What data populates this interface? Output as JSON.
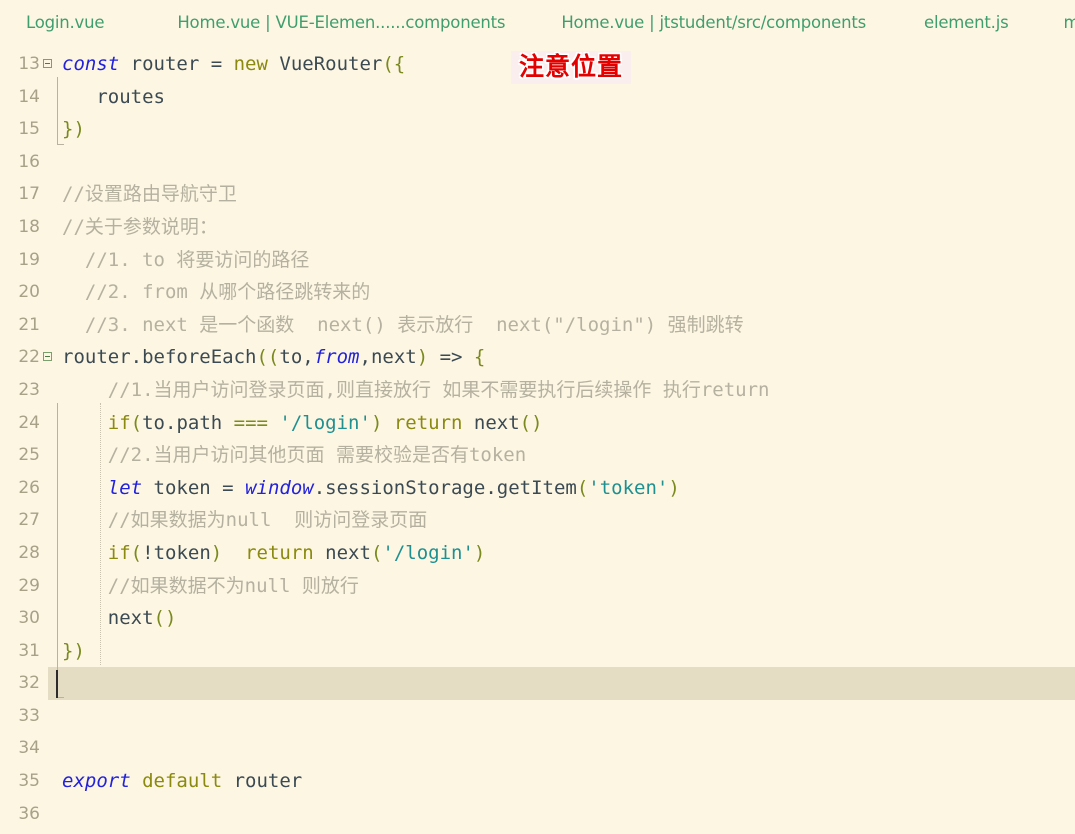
{
  "colors": {
    "editor_background": "#fdf6e3",
    "tab_text": "#3f9e6d",
    "line_number": "#a8a188",
    "comment": "#b5b1a0",
    "keyword": "#2222dd",
    "keyword2": "#8a8a10",
    "string": "#1f9090",
    "identifier": "#3b4a52",
    "current_line_highlight": "#e4dcc3",
    "annotation_text": "#e50000",
    "annotation_background": "#fbeeee"
  },
  "tabs": [
    {
      "label": "Login.vue"
    },
    {
      "label": "Home.vue | VUE-Elemen......components"
    },
    {
      "label": "Home.vue | jtstudent/src/components"
    },
    {
      "label": "element.js"
    },
    {
      "label": "m"
    }
  ],
  "annotation": {
    "text": "注意位置"
  },
  "editor": {
    "current_line": 32,
    "first_line": 13,
    "last_line": 36,
    "lines": [
      {
        "number": "13",
        "text": "const router = new VueRouter({"
      },
      {
        "number": "14",
        "text": "  routes"
      },
      {
        "number": "15",
        "text": "})"
      },
      {
        "number": "16",
        "text": ""
      },
      {
        "number": "17",
        "text": "//设置路由导航守卫"
      },
      {
        "number": "18",
        "text": "//关于参数说明："
      },
      {
        "number": "19",
        "text": "  //1. to 将要访问的路径"
      },
      {
        "number": "20",
        "text": "  //2. from 从哪个路径跳转来的"
      },
      {
        "number": "21",
        "text": "  //3. next 是一个函数  next() 表示放行  next(\"/login\") 强制跳转"
      },
      {
        "number": "22",
        "text": "router.beforeEach((to,from,next) => {"
      },
      {
        "number": "23",
        "text": "    //1.当用户访问登录页面,则直接放行 如果不需要执行后续操作 执行return"
      },
      {
        "number": "24",
        "text": "    if(to.path === '/login') return next()"
      },
      {
        "number": "25",
        "text": "    //2.当用户访问其他页面 需要校验是否有token"
      },
      {
        "number": "26",
        "text": "    let token = window.sessionStorage.getItem('token')"
      },
      {
        "number": "27",
        "text": "    //如果数据为null  则访问登录页面"
      },
      {
        "number": "28",
        "text": "    if(!token)  return next('/login')"
      },
      {
        "number": "29",
        "text": "    //如果数据不为null 则放行"
      },
      {
        "number": "30",
        "text": "    next()"
      },
      {
        "number": "31",
        "text": "})"
      },
      {
        "number": "32",
        "text": ""
      },
      {
        "number": "33",
        "text": ""
      },
      {
        "number": "34",
        "text": ""
      },
      {
        "number": "35",
        "text": "export default router"
      },
      {
        "number": "36",
        "text": ""
      }
    ]
  }
}
